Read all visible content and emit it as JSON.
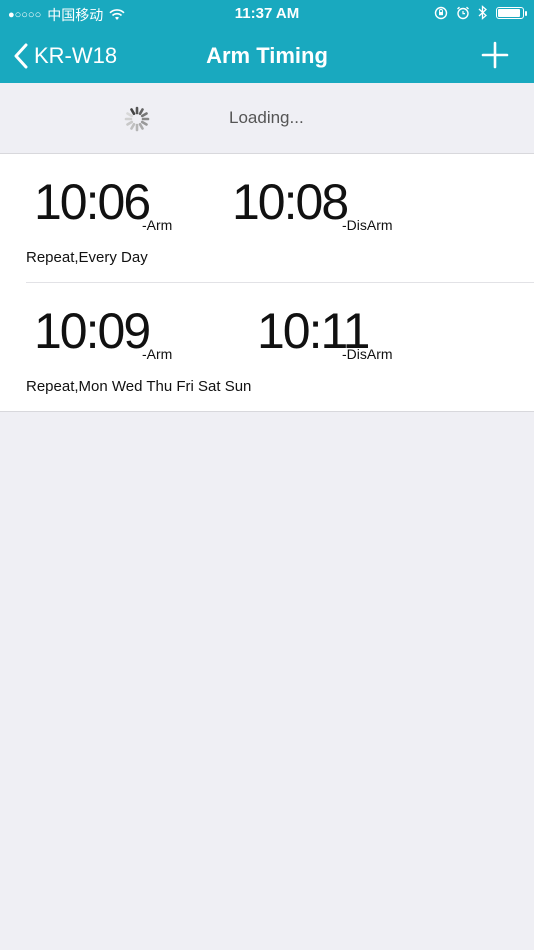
{
  "status_bar": {
    "signal": "●○○○○",
    "carrier": "中国移动",
    "time": "11:37 AM"
  },
  "nav": {
    "back_label": "KR-W18",
    "title": "Arm Timing"
  },
  "loading": {
    "text": "Loading..."
  },
  "timers": [
    {
      "arm_time": "10:06",
      "arm_suffix": "-Arm",
      "disarm_time": "10:08",
      "disarm_suffix": "-DisArm",
      "repeat": "Repeat,Every Day"
    },
    {
      "arm_time": "10:09",
      "arm_suffix": "-Arm",
      "disarm_time": "10:11",
      "disarm_suffix": "-DisArm",
      "repeat": "Repeat,Mon Wed Thu Fri Sat Sun"
    }
  ],
  "colors": {
    "accent": "#19a9bf",
    "background": "#efeff4"
  }
}
